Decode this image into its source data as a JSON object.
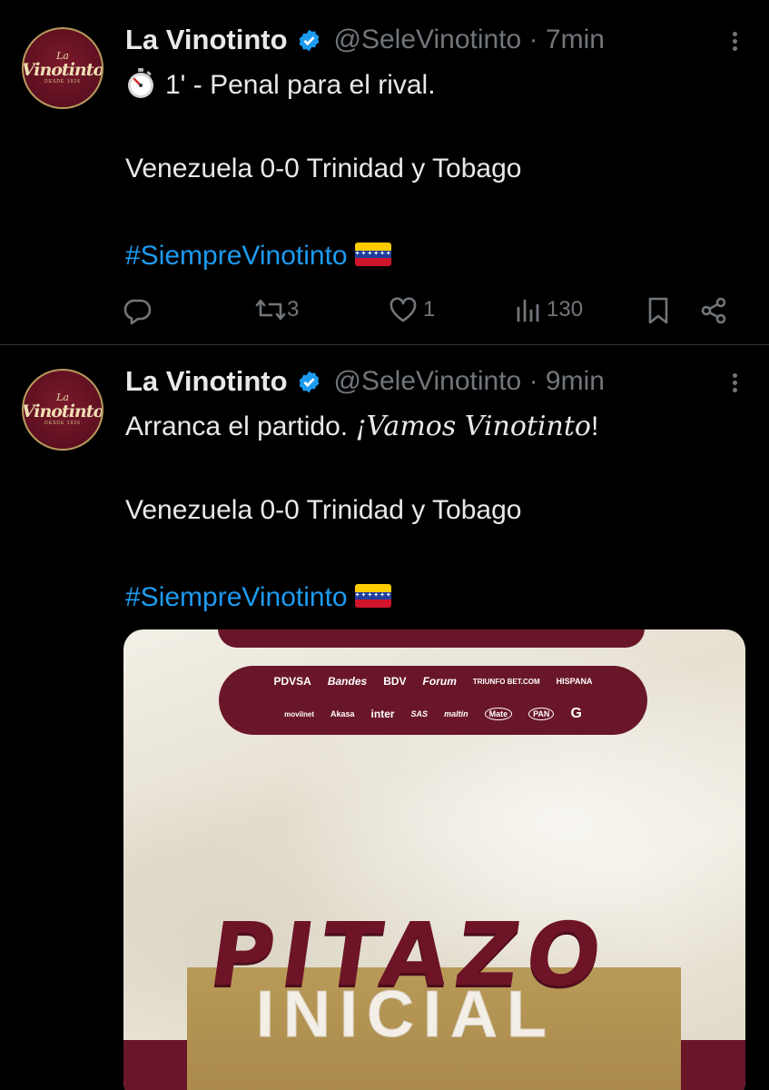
{
  "tweets": [
    {
      "author": "La Vinotinto",
      "handle": "@SeleVinotinto · 7min",
      "avatar_text": {
        "small": "La",
        "main": "Vinotinto",
        "tiny": "DESDE 1926"
      },
      "text_line1": "1' - Penal para el rival.",
      "text_line2": "Venezuela 0-0 Trinidad y Tobago",
      "hashtag": "#SiempreVinotinto",
      "actions": {
        "reposts": "3",
        "likes": "1",
        "views": "130"
      }
    },
    {
      "author": "La Vinotinto",
      "handle": "@SeleVinotinto · 9min",
      "avatar_text": {
        "small": "La",
        "main": "Vinotinto",
        "tiny": "DESDE 1926"
      },
      "text_line1_pre": "Arranca el partido. ",
      "text_line1_italic": "¡Vamos Vinotinto",
      "text_line1_post": "!",
      "text_line2": "Venezuela 0-0 Trinidad y Tobago",
      "hashtag": "#SiempreVinotinto",
      "media": {
        "sponsors_row1": [
          "PDVSA",
          "Bandes",
          "BDV",
          "Forum",
          "TRIUNFO BET.COM",
          "HISPANA"
        ],
        "sponsors_row2": [
          "movilnet",
          "Akasa",
          "inter",
          "SAS",
          "maltin",
          "Mate",
          "PAN",
          "G"
        ],
        "headline1": "PITAZO",
        "headline2": "INICIAL"
      }
    }
  ],
  "colors": {
    "background": "#000000",
    "text": "#e7e9ea",
    "muted": "#71767b",
    "link": "#1d9bf0",
    "verified": "#1d9bf0",
    "maroon": "#6a1629",
    "gold": "#b59552"
  }
}
